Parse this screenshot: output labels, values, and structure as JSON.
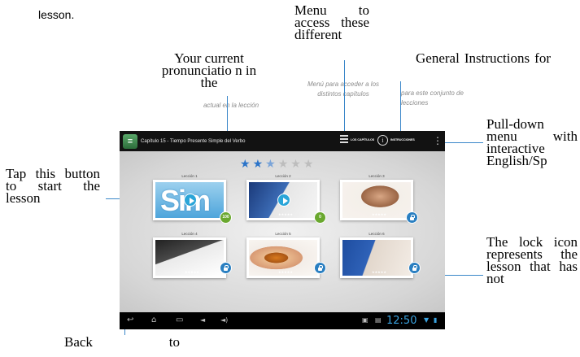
{
  "callouts": {
    "top_left": "lesson.",
    "menu": "Menu to access these different",
    "pronunciation": "Your current pronunciatio n in the",
    "general": "General Instructions for",
    "pulldown": "Pull-down menu with interactive English/Sp",
    "tap": "Tap this button to start the lesson",
    "lock": "The lock icon represents the lesson that has not",
    "back": "Back to"
  },
  "notes": {
    "actual": "actual en la lección",
    "menu": "Menú para acceder a los distintos capítulos",
    "instrucciones": "para este conjunto de lecciones"
  },
  "tablet": {
    "chapter_title": "Capítulo 15 - Tiempo Presente Simple del Verbo",
    "menu_label": "LOS CAPÍTULOS",
    "instructions_label": "INSTRUCCIONES",
    "overflow_icon": "more-vert-icon",
    "rating": {
      "full": 2,
      "half": 1,
      "empty": 3
    },
    "lessons": [
      {
        "name": "Lección 1",
        "badge": "100",
        "badge_type": "score",
        "art": "sim",
        "art_text": "Sim"
      },
      {
        "name": "Lección 2",
        "badge": "0",
        "badge_type": "score",
        "art": "man"
      },
      {
        "name": "Lección 3",
        "badge": "",
        "badge_type": "lock",
        "art": "woman"
      },
      {
        "name": "Lección 4",
        "badge": "",
        "badge_type": "lock",
        "art": "hand"
      },
      {
        "name": "Lección 5",
        "badge": "",
        "badge_type": "lock",
        "art": "apple"
      },
      {
        "name": "Lección 6",
        "badge": "",
        "badge_type": "lock",
        "art": "folder"
      }
    ],
    "clock": "12:50"
  },
  "colors": {
    "accent": "#2aa5d8",
    "score_badge": "#6aa82f",
    "lock_badge": "#2a7fc1",
    "callout_line": "#3a87c9"
  }
}
